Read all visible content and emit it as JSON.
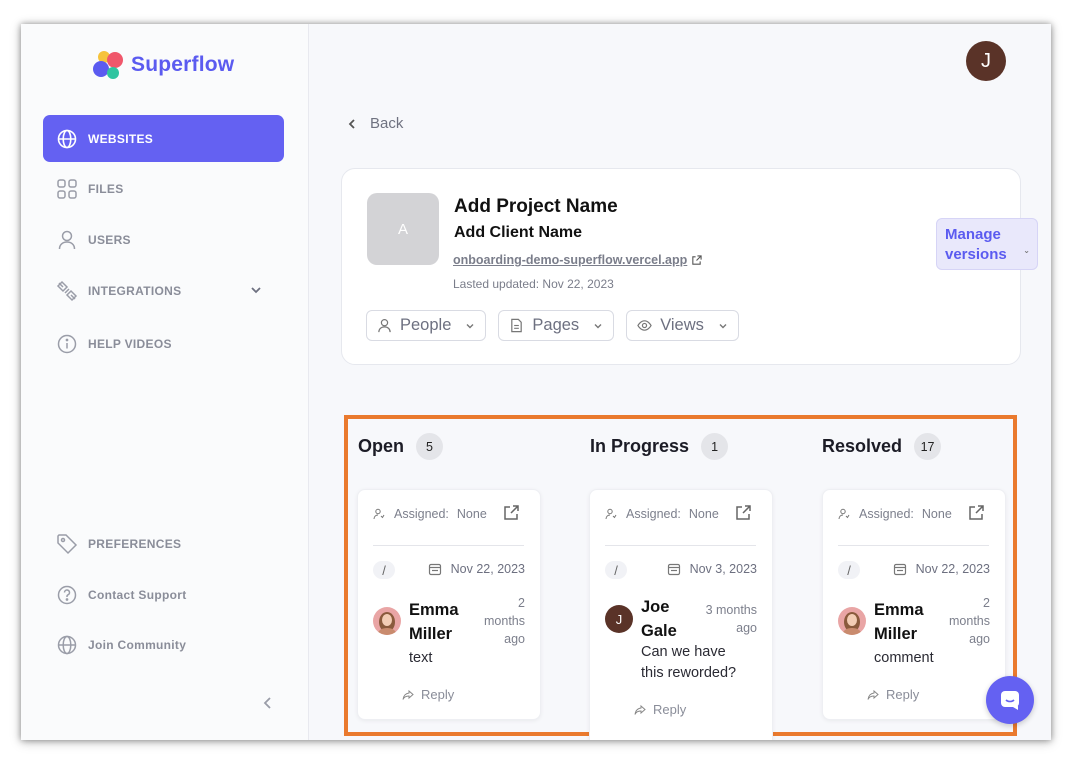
{
  "brand": {
    "name": "Superflow"
  },
  "sidebar": {
    "items": [
      {
        "label": "WEBSITES",
        "icon": "globe-icon"
      },
      {
        "label": "FILES",
        "icon": "grid-icon"
      },
      {
        "label": "USERS",
        "icon": "user-icon"
      },
      {
        "label": "INTEGRATIONS",
        "icon": "plug-icon"
      },
      {
        "label": "HELP VIDEOS",
        "icon": "info-icon"
      }
    ],
    "footer": [
      {
        "label": "PREFERENCES",
        "icon": "tag-icon"
      },
      {
        "label": "Contact Support",
        "icon": "question-icon"
      },
      {
        "label": "Join Community",
        "icon": "globe-icon"
      }
    ]
  },
  "header": {
    "avatar_initial": "J"
  },
  "nav": {
    "back_label": "Back"
  },
  "project": {
    "thumb_initial": "A",
    "name": "Add Project Name",
    "client": "Add Client Name",
    "url": "onboarding-demo-superflow.vercel.app",
    "updated": "Lasted updated: Nov 22, 2023",
    "manage_label": "Manage versions",
    "filters": [
      {
        "label": "People",
        "icon": "person-icon"
      },
      {
        "label": "Pages",
        "icon": "page-icon"
      },
      {
        "label": "Views",
        "icon": "eye-icon"
      }
    ]
  },
  "columns": [
    {
      "title": "Open",
      "count": "5",
      "card": {
        "assigned_label": "Assigned:",
        "assigned_value": "None",
        "slash": "/",
        "date": "Nov 22, 2023",
        "author_first": "Emma",
        "author_last": "Miller",
        "time": [
          "2",
          "months",
          "ago"
        ],
        "text": "text",
        "reply": "Reply"
      }
    },
    {
      "title": "In Progress",
      "count": "1",
      "card": {
        "assigned_label": "Assigned:",
        "assigned_value": "None",
        "slash": "/",
        "date": "Nov 3, 2023",
        "author_initial": "J",
        "author_first": "Joe",
        "author_last": "Gale",
        "time": [
          "3 months",
          "ago"
        ],
        "text_lines": [
          "Can we have",
          "this reworded?"
        ],
        "reply": "Reply"
      }
    },
    {
      "title": "Resolved",
      "count": "17",
      "card": {
        "assigned_label": "Assigned:",
        "assigned_value": "None",
        "slash": "/",
        "date": "Nov 22, 2023",
        "author_first": "Emma",
        "author_last": "Miller",
        "time": [
          "2",
          "months",
          "ago"
        ],
        "text": "comment",
        "reply": "Reply"
      }
    }
  ],
  "colors": {
    "accent": "#6461f2",
    "highlight": "#ea7a2e",
    "avatar": "#5a3328"
  }
}
